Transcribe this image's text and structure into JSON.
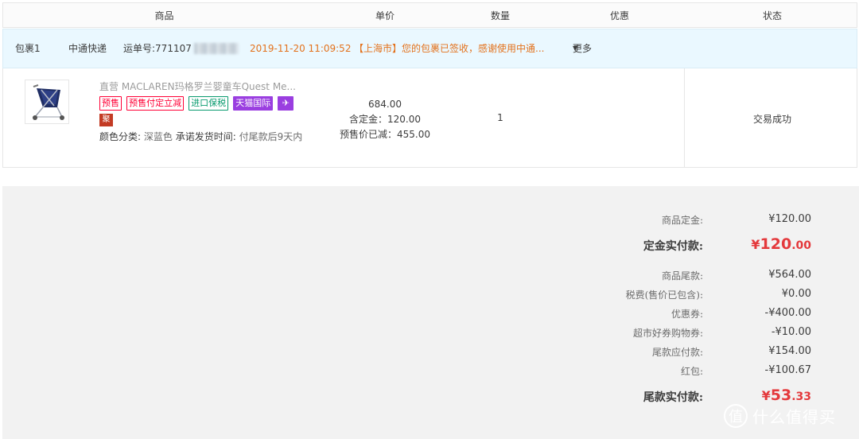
{
  "header": {
    "col_product": "商品",
    "col_price": "单价",
    "col_qty": "数量",
    "col_discount": "优惠",
    "col_status": "状态"
  },
  "package": {
    "name": "包裹1",
    "carrier": "中通快递",
    "tracking_label": "运单号:771107",
    "datetime": "2019-11-20 11:09:52",
    "message": "【上海市】您的包裹已签收，感谢使用中通...",
    "more": "更多"
  },
  "order": {
    "product_name": "直营 MACLAREN玛格罗兰婴童车Quest Me...",
    "tags": [
      "预售",
      "预售付定立减",
      "进口保税",
      "天猫国际"
    ],
    "tag_extra": "聚",
    "attr_label": "颜色分类:",
    "attr_value": "深蓝色",
    "ship_label": "承诺发货时间:",
    "ship_value": "付尾款后9天内",
    "price": "684.00",
    "deposit": "含定金：120.00",
    "presale_reduce": "预售价已减：455.00",
    "quantity": "1",
    "status": "交易成功"
  },
  "summary": {
    "deposit_label": "商品定金:",
    "deposit_value": "¥120.00",
    "deposit_paid_label": "定金实付款:",
    "deposit_paid_yen": "¥",
    "deposit_paid_int": "120",
    "deposit_paid_dec": ".00",
    "balance_label": "商品尾款:",
    "balance_value": "¥564.00",
    "tax_label": "税费(售价已包含):",
    "tax_value": "¥0.00",
    "coupon_label": "优惠券:",
    "coupon_value": "-¥400.00",
    "market_coupon_label": "超市好券购物券:",
    "market_coupon_value": "-¥10.00",
    "balance_due_label": "尾款应付款:",
    "balance_due_value": "¥154.00",
    "redpacket_label": "红包:",
    "redpacket_value": "-¥100.67",
    "final_paid_label": "尾款实付款:",
    "final_paid_yen": "¥",
    "final_paid_int": "53",
    "final_paid_dec": ".33"
  },
  "watermark": {
    "icon": "值",
    "text": "什么值得买"
  },
  "colors": {
    "accent_red": "#e4393c",
    "orange": "#e3721d",
    "pkg_bg": "#eaf8ff"
  }
}
